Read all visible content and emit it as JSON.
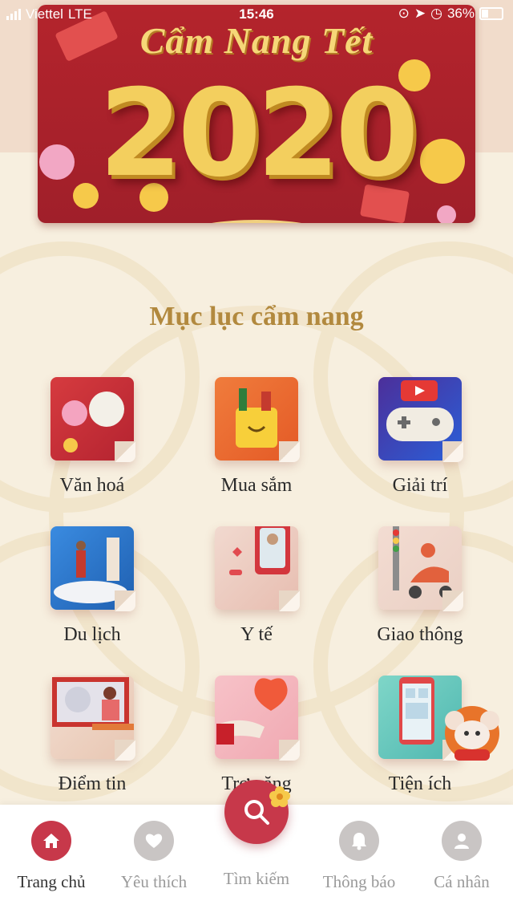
{
  "status_bar": {
    "carrier": "Viettel",
    "network": "LTE",
    "time": "15:46",
    "battery": "36%"
  },
  "banner": {
    "title": "Cẩm Nang Tết",
    "year": "2020"
  },
  "section_title": "Mục lục cẩm nang",
  "categories": [
    {
      "label": "Văn hoá",
      "icon": "lion-dance-icon"
    },
    {
      "label": "Mua sắm",
      "icon": "shopping-bag-icon"
    },
    {
      "label": "Giải trí",
      "icon": "gamepad-icon"
    },
    {
      "label": "Du lịch",
      "icon": "travel-icon"
    },
    {
      "label": "Y tế",
      "icon": "medical-icon"
    },
    {
      "label": "Giao thông",
      "icon": "scooter-icon"
    },
    {
      "label": "Điểm tin",
      "icon": "news-icon"
    },
    {
      "label": "Trợ năng",
      "icon": "heart-hand-icon"
    },
    {
      "label": "Tiện ích",
      "icon": "phone-utility-icon"
    }
  ],
  "tabbar": {
    "home": "Trang chủ",
    "favorites": "Yêu thích",
    "search": "Tìm kiếm",
    "notifications": "Thông báo",
    "profile": "Cá nhân"
  },
  "colors": {
    "accent": "#c7384a",
    "section_title": "#b2893e",
    "banner": "#b4242c"
  }
}
